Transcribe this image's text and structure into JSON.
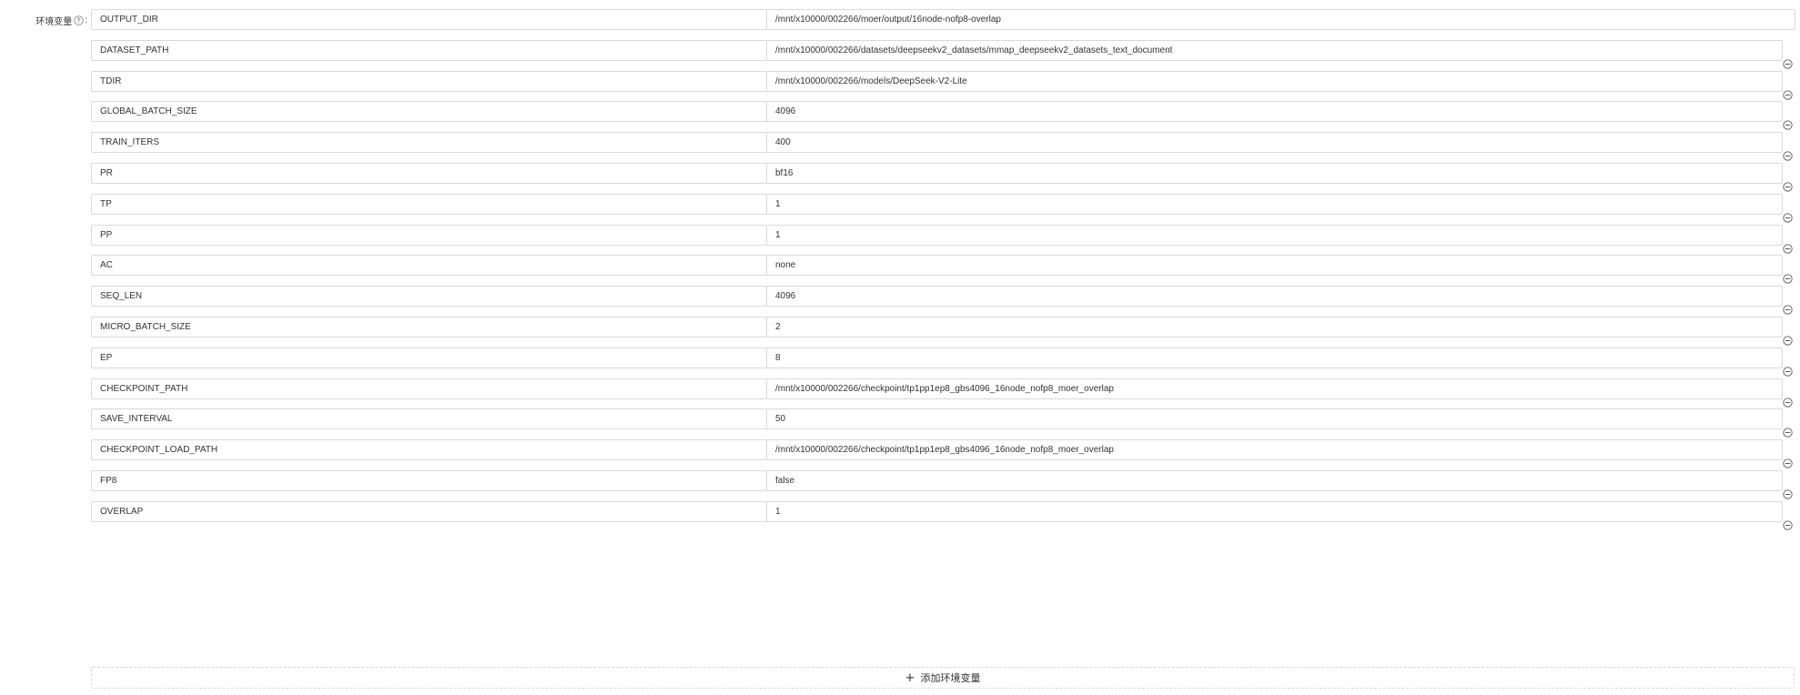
{
  "form": {
    "label": "环境变量",
    "help_icon": "question-circle-icon",
    "colon": ":"
  },
  "env_vars": [
    {
      "key": "OUTPUT_DIR",
      "value": "/mnt/x10000/002266/moer/output/16node-nofp8-overlap"
    },
    {
      "key": "DATASET_PATH",
      "value": "/mnt/x10000/002266/datasets/deepseekv2_datasets/mmap_deepseekv2_datasets_text_document"
    },
    {
      "key": "TDIR",
      "value": "/mnt/x10000/002266/models/DeepSeek-V2-Lite"
    },
    {
      "key": "GLOBAL_BATCH_SIZE",
      "value": "4096"
    },
    {
      "key": "TRAIN_ITERS",
      "value": "400"
    },
    {
      "key": "PR",
      "value": "bf16"
    },
    {
      "key": "TP",
      "value": "1"
    },
    {
      "key": "PP",
      "value": "1"
    },
    {
      "key": "AC",
      "value": "none"
    },
    {
      "key": "SEQ_LEN",
      "value": "4096"
    },
    {
      "key": "MICRO_BATCH_SIZE",
      "value": "2"
    },
    {
      "key": "EP",
      "value": "8"
    },
    {
      "key": "CHECKPOINT_PATH",
      "value": "/mnt/x10000/002266/checkpoint/tp1pp1ep8_gbs4096_16node_nofp8_moer_overlap"
    },
    {
      "key": "SAVE_INTERVAL",
      "value": "50"
    },
    {
      "key": "CHECKPOINT_LOAD_PATH",
      "value": "/mnt/x10000/002266/checkpoint/tp1pp1ep8_gbs4096_16node_nofp8_moer_overlap"
    },
    {
      "key": "FP8",
      "value": "false"
    },
    {
      "key": "OVERLAP",
      "value": "1"
    }
  ],
  "remove_icon": "minus-circle-icon",
  "add_button": {
    "icon": "plus-icon",
    "label": "添加环境变量"
  },
  "colors": {
    "border": "#d9d9d9",
    "text": "#333333",
    "background": "#ffffff"
  }
}
